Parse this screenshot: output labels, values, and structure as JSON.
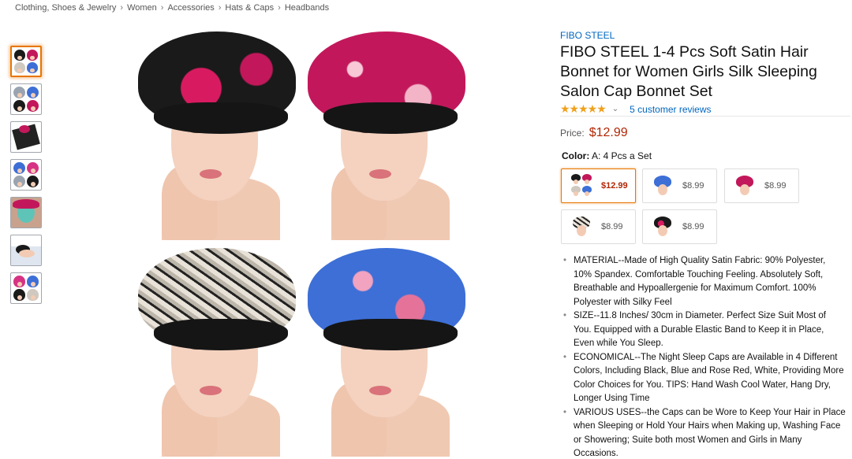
{
  "breadcrumb": [
    "Clothing, Shoes & Jewelry",
    "Women",
    "Accessories",
    "Hats & Caps",
    "Headbands"
  ],
  "breadcrumb_separator": "›",
  "product": {
    "brand": "FIBO STEEL",
    "title": "FIBO STEEL 1-4 Pcs Soft Satin Hair Bonnet for Women Girls Silk Sleeping Salon Cap Bonnet Set",
    "stars": "★★★★★",
    "rating_chevron": "⌄",
    "reviews": "5 customer reviews",
    "price_label": "Price:",
    "price": "$12.99",
    "color_label": "Color:",
    "color_value": "A: 4 Pcs a Set"
  },
  "swatches": [
    {
      "price": "$12.99",
      "selected": true
    },
    {
      "price": "$8.99"
    },
    {
      "price": "$8.99"
    },
    {
      "price": "$8.99"
    },
    {
      "price": "$8.99"
    }
  ],
  "bullets": [
    "MATERIAL--Made of High Quality Satin Fabric: 90% Polyester, 10% Spandex. Comfortable Touching Feeling. Absolutely Soft, Breathable and Hypoallergenie for Maximum Comfort. 100% Polyester with Silky Feel",
    "SIZE--11.8 Inches/ 30cm in Diameter. Perfect Size Suit Most of You. Equipped with a Durable Elastic Band to Keep it in Place, Even while You Sleep.",
    "ECONOMICAL--The Night Sleep Caps are Available in 4 Different Colors, Including Black, Blue and Rose Red, White, Providing More Color Choices for You. TIPS: Hand Wash Cool Water, Hang Dry, Longer Using Time",
    "VARIOUS USES--the Caps can be Wore to Keep Your Hair in Place when Sleeping or Hold Your Hairs when Making up, Washing Face or Showering; Suite both most Women and Girls in Many Occasions."
  ],
  "colors": {
    "link": "#0066c0",
    "price": "#b12704",
    "selected_border": "#e77600",
    "star": "#f0a01c",
    "cap_black_floral": "#1a1a1a",
    "cap_rose": "#c2185b",
    "cap_leopard": "#cfc9c0",
    "cap_blue": "#3d6fd6"
  }
}
